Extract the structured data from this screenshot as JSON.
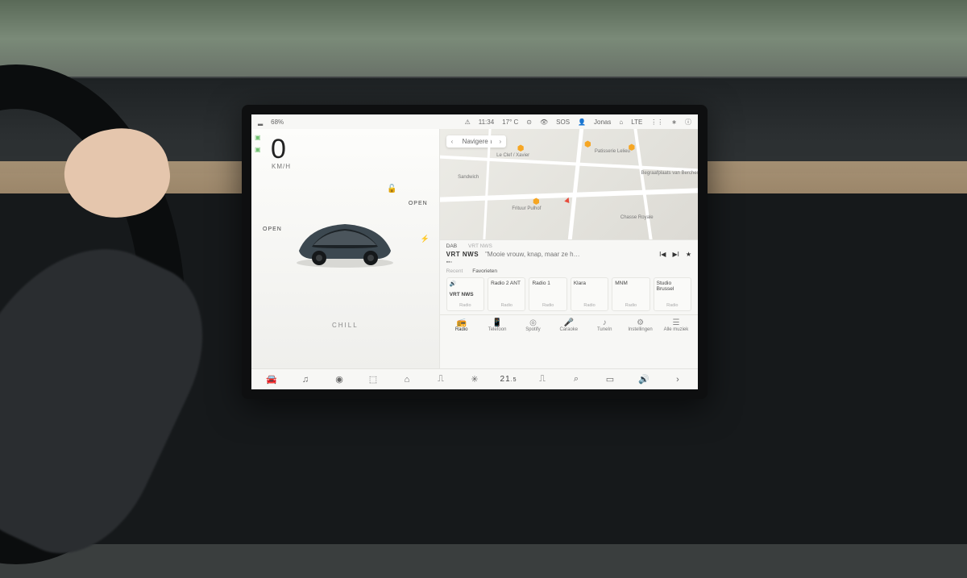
{
  "status": {
    "battery_pct": "68%",
    "time": "11:34",
    "temp_out": "17° C",
    "sos": "SOS",
    "profile": "Jonas",
    "net": "LTE"
  },
  "drive": {
    "speed": "0",
    "unit": "KM/H",
    "doors_left": "OPEN",
    "doors_right": "OPEN",
    "mode": "CHILL"
  },
  "map": {
    "nav_placeholder": "Navigeren",
    "pois": {
      "leclef": "Le Clef / Xavier",
      "sandwich": "Sandwich",
      "frituur": "Frituur Pulhof",
      "pat": "Patisserie Lelieu",
      "park": "Begraafplaats van Berchem",
      "chasse": "Chasse Royale"
    }
  },
  "media": {
    "band_tabs": {
      "dab": "DAB",
      "src": "VRT NWS"
    },
    "station": "VRT NWS",
    "track": "\"Mooie vrouw, knap, maar ze h…",
    "fav_tabs": {
      "recent": "Recent",
      "fav": "Favorieten"
    },
    "presets": [
      {
        "name": "VRT NWS",
        "sub": "Radio",
        "on": true
      },
      {
        "name": "Radio 2 ANT",
        "sub": "Radio"
      },
      {
        "name": "Radio 1",
        "sub": "Radio"
      },
      {
        "name": "Klara",
        "sub": "Radio"
      },
      {
        "name": "MNM",
        "sub": "Radio"
      },
      {
        "name": "Studio Brussel",
        "sub": "Radio"
      }
    ],
    "sources": [
      {
        "name": "Radio",
        "icon": "📻",
        "on": true
      },
      {
        "name": "Telefoon",
        "icon": "📱"
      },
      {
        "name": "Spotify",
        "icon": "◎"
      },
      {
        "name": "Caraoke",
        "icon": "🎤"
      },
      {
        "name": "TuneIn",
        "icon": "♪"
      },
      {
        "name": "Instellingen",
        "icon": "⚙"
      },
      {
        "name": "Alle muziek",
        "icon": "☰"
      }
    ]
  },
  "dock": {
    "temp": "21",
    "temp_frac": ".5"
  }
}
